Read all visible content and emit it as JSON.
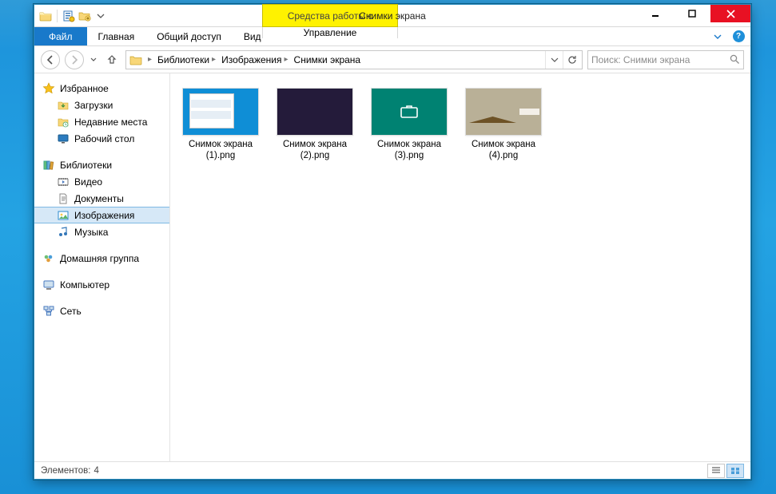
{
  "window": {
    "title": "Снимки экрана",
    "context_tab_header": "Средства работы с рисунками"
  },
  "ribbon": {
    "file": "Файл",
    "tabs": [
      "Главная",
      "Общий доступ",
      "Вид"
    ],
    "context_tab": "Управление"
  },
  "breadcrumbs": [
    "Библиотеки",
    "Изображения",
    "Снимки экрана"
  ],
  "search": {
    "placeholder": "Поиск: Снимки экрана"
  },
  "sidebar": {
    "favorites": {
      "label": "Избранное",
      "items": [
        "Загрузки",
        "Недавние места",
        "Рабочий стол"
      ]
    },
    "libraries": {
      "label": "Библиотеки",
      "items": [
        "Видео",
        "Документы",
        "Изображения",
        "Музыка"
      ],
      "selected_index": 2
    },
    "homegroup": {
      "label": "Домашняя группа"
    },
    "computer": {
      "label": "Компьютер"
    },
    "network": {
      "label": "Сеть"
    }
  },
  "files": [
    {
      "name": "Снимок экрана (1).png"
    },
    {
      "name": "Снимок экрана (2).png"
    },
    {
      "name": "Снимок экрана (3).png"
    },
    {
      "name": "Снимок экрана (4).png"
    }
  ],
  "status": {
    "label": "Элементов:",
    "count": "4"
  },
  "tile_colors": [
    "#3aa757",
    "#e8711f",
    "#117a9e",
    "#d13438",
    "#8764b8",
    "#2d7d9a",
    "#ff8c00",
    "#e3008c",
    "#008272",
    "#5c2d91",
    "#0078d7",
    "#2b88d8",
    "#b4a0ff",
    "#107c10",
    "#f7630c",
    "#c30052",
    "#00b294",
    "#6b69d6"
  ]
}
